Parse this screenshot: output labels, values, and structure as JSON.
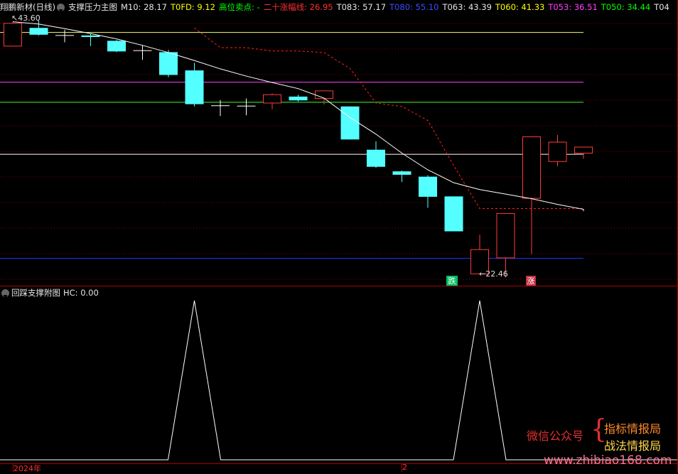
{
  "main_header": {
    "stock": "翔鹏新材(日线)",
    "indicator": "支撑压力主图",
    "items": [
      {
        "label": "M10: 28.17",
        "color": "#e6e6e6"
      },
      {
        "label": "T0FD: 9.12",
        "color": "#ffff00"
      },
      {
        "label": "高位卖点: -",
        "color": "#00ff00"
      },
      {
        "label": "二十涨幅线: 26.95",
        "color": "#ff3030"
      },
      {
        "label": "T083: 57.17",
        "color": "#e6e6e6"
      },
      {
        "label": "T080: 55.10",
        "color": "#3b4bff"
      },
      {
        "label": "T063: 43.39",
        "color": "#e6e6e6"
      },
      {
        "label": "T060: 41.33",
        "color": "#ffff00"
      },
      {
        "label": "T053: 36.51",
        "color": "#ff40ff"
      },
      {
        "label": "T050: 34.44",
        "color": "#00ff00"
      },
      {
        "label": "T04",
        "color": "#e6e6e6"
      }
    ]
  },
  "sub_header": {
    "indicator": "回踩支撑附图",
    "value": "HC: 0.00"
  },
  "annotations": {
    "high": "43.60",
    "low": "22.46",
    "buy_tag": "跌",
    "sell_tag": "涨"
  },
  "axis": {
    "year": "2024年",
    "month": "2"
  },
  "watermark": {
    "wechat": "微信公众号",
    "brace": "{",
    "name1": "指标情报局",
    "name2": "战法情报局",
    "url": "www.zhibiao168.com"
  },
  "colors": {
    "up": "#ff3a3a",
    "down": "#54ffff",
    "ma": "#ffffff",
    "sell_line": "#ff2020"
  },
  "chart_data": {
    "type": "candlestick",
    "candles": [
      {
        "o": 37.2,
        "c": 43.2,
        "h": 43.6,
        "l": 37.2
      },
      {
        "o": 42.0,
        "c": 40.2,
        "h": 44.0,
        "l": 40.0
      },
      {
        "o": 40.0,
        "c": 40.0,
        "h": 41.5,
        "l": 38.2
      },
      {
        "o": 40.0,
        "c": 39.6,
        "h": 40.4,
        "l": 37.2
      },
      {
        "o": 38.6,
        "c": 35.8,
        "h": 38.8,
        "l": 35.6
      },
      {
        "o": 36.0,
        "c": 36.0,
        "h": 37.4,
        "l": 33.6
      },
      {
        "o": 35.6,
        "c": 29.6,
        "h": 36.2,
        "l": 29.0
      },
      {
        "o": 30.8,
        "c": 21.9,
        "h": 32.8,
        "l": 21.3
      },
      {
        "o": 21.5,
        "c": 21.5,
        "h": 23.0,
        "l": 18.8
      },
      {
        "o": 21.4,
        "c": 21.4,
        "h": 23.4,
        "l": 19.0
      },
      {
        "o": 22.2,
        "c": 24.4,
        "h": 24.8,
        "l": 20.6
      },
      {
        "o": 23.9,
        "c": 22.9,
        "h": 24.4,
        "l": 22.6
      },
      {
        "o": 23.4,
        "c": 25.4,
        "h": 25.5,
        "l": 21.8
      },
      {
        "o": 21.3,
        "c": 12.6,
        "h": 21.3,
        "l": 12.6
      },
      {
        "o": 9.9,
        "c": 5.4,
        "h": 12.1,
        "l": 5.1
      },
      {
        "o": 4.2,
        "c": 3.3,
        "h": 4.4,
        "l": 1.4
      },
      {
        "o": 2.8,
        "c": -2.5,
        "h": 3.2,
        "l": -5.4
      },
      {
        "o": -2.4,
        "c": -11.6,
        "h": -2.4,
        "l": -11.6
      },
      {
        "o": -22.8,
        "c": -16.4,
        "h": -12.5,
        "l": -22.8
      },
      {
        "o": -18.6,
        "c": -6.9,
        "h": -6.9,
        "l": -23.8
      },
      {
        "o": -2.9,
        "c": 13.3,
        "h": 13.3,
        "l": -17.6
      },
      {
        "o": 6.8,
        "c": 11.9,
        "h": 13.8,
        "l": 5.5
      },
      {
        "o": 9.0,
        "c": 10.6,
        "h": 10.6,
        "l": 7.5
      }
    ],
    "m10": [
      43.6,
      43.0,
      41.8,
      40.5,
      39.1,
      37.4,
      35.5,
      33.4,
      31.2,
      29.3,
      27.6,
      26.0,
      23.5,
      18.4,
      14.0,
      9.0,
      4.6,
      1.2,
      -0.6,
      -1.8,
      -3.0,
      -4.5,
      -5.8
    ],
    "sell_line": [
      null,
      null,
      null,
      null,
      null,
      null,
      null,
      42.0,
      36.8,
      36.8,
      35.9,
      35.9,
      35.5,
      31.3,
      22.2,
      21.3,
      17.6,
      5.7,
      -5.6,
      -5.6,
      -5.6,
      -5.6,
      -5.6
    ],
    "levels": [
      {
        "value": 40.8,
        "color": "#ffff66"
      },
      {
        "value": 27.7,
        "color": "#ff40ff"
      },
      {
        "value": 22.4,
        "color": "#33ff33"
      },
      {
        "value": 8.7,
        "color": "#ffffff"
      },
      {
        "value": -18.7,
        "color": "#2030ff"
      }
    ],
    "hc": [
      0,
      0,
      0,
      0,
      0,
      0,
      0,
      1,
      0,
      0,
      0,
      0,
      0,
      0,
      0,
      0,
      0,
      0,
      1,
      0,
      0,
      0,
      0
    ]
  }
}
